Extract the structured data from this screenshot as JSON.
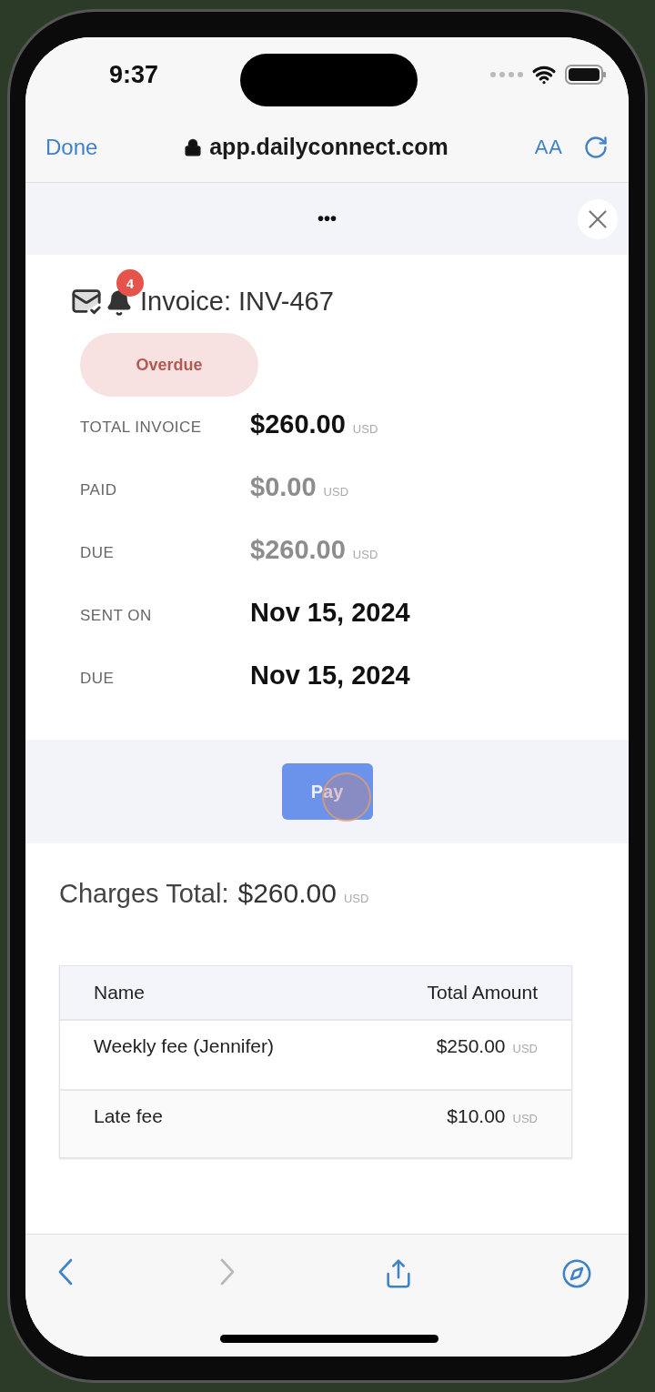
{
  "status_bar": {
    "time": "9:37"
  },
  "browser": {
    "done": "Done",
    "url": "app.dailyconnect.com",
    "text_size": "AA"
  },
  "sheet": {
    "handle": "•••"
  },
  "invoice": {
    "title": "Invoice: INV-467",
    "notification_count": "4",
    "status": "Overdue",
    "details": [
      {
        "label": "TOTAL INVOICE",
        "value": "$260.00",
        "currency": "USD",
        "muted": false
      },
      {
        "label": "PAID",
        "value": "$0.00",
        "currency": "USD",
        "muted": true
      },
      {
        "label": "DUE",
        "value": "$260.00",
        "currency": "USD",
        "muted": true
      },
      {
        "label": "SENT ON",
        "value": "Nov 15, 2024",
        "muted": false
      },
      {
        "label": "DUE",
        "value": "Nov 15, 2024",
        "muted": false
      }
    ],
    "pay_button": "Pay",
    "charges_total": {
      "label": "Charges Total:",
      "value": "$260.00",
      "currency": "USD"
    },
    "table": {
      "columns": [
        "Name",
        "Total Amount"
      ],
      "rows": [
        {
          "name": "Weekly fee (Jennifer)",
          "amount": "$250.00",
          "currency": "USD"
        },
        {
          "name": "Late fee",
          "amount": "$10.00",
          "currency": "USD"
        }
      ]
    }
  },
  "toolbar": [
    {
      "kind": "back",
      "disabled": false
    },
    {
      "kind": "forward",
      "disabled": true
    },
    {
      "kind": "share",
      "disabled": false
    },
    {
      "kind": "compass",
      "disabled": false
    }
  ]
}
